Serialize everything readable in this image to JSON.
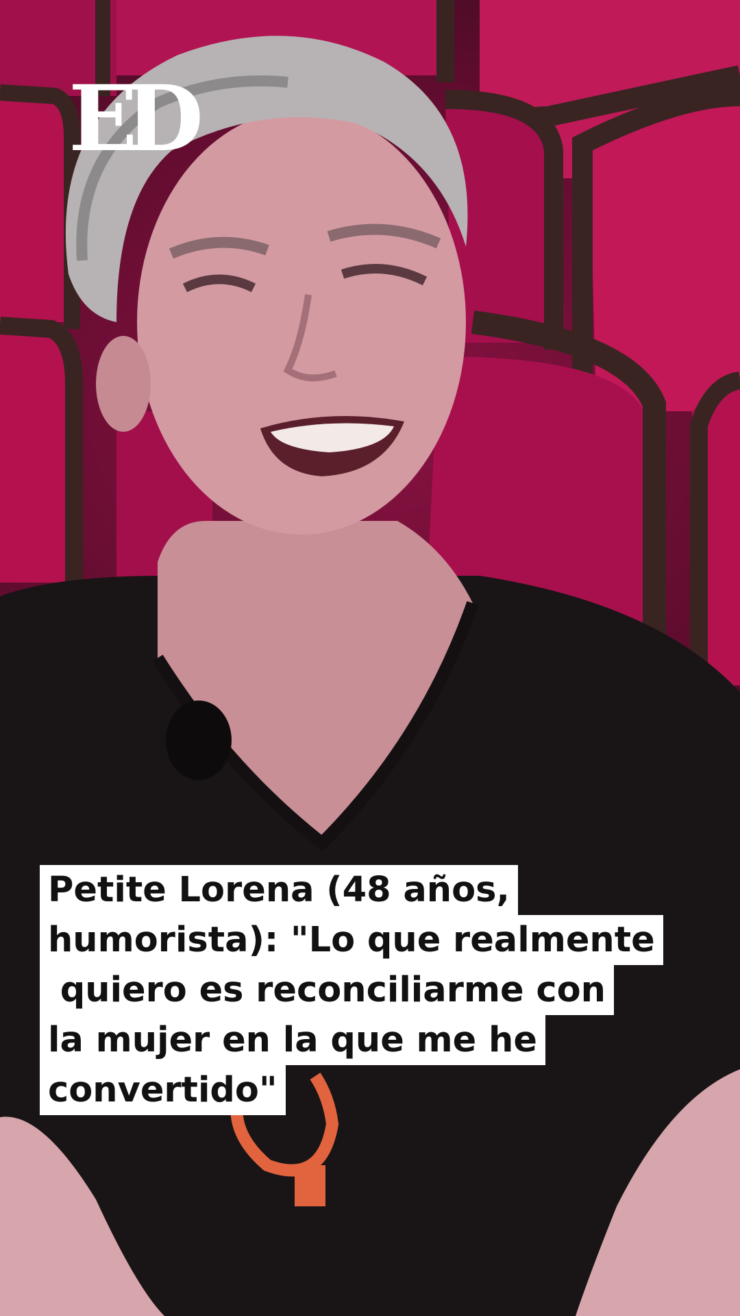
{
  "logo": {
    "text": "ED"
  },
  "caption": {
    "lines": [
      "Petite Lorena (48 años,",
      "humorista): \"Lo que realmente",
      " quiero es reconciliarme con",
      "la mujer en la que me he",
      "convertido\""
    ]
  },
  "colors": {
    "seat_velvet": "#b0104f",
    "seat_frame": "#3a2422",
    "caption_bg": "#ffffff",
    "caption_text": "#111111",
    "logo": "#ffffff"
  }
}
